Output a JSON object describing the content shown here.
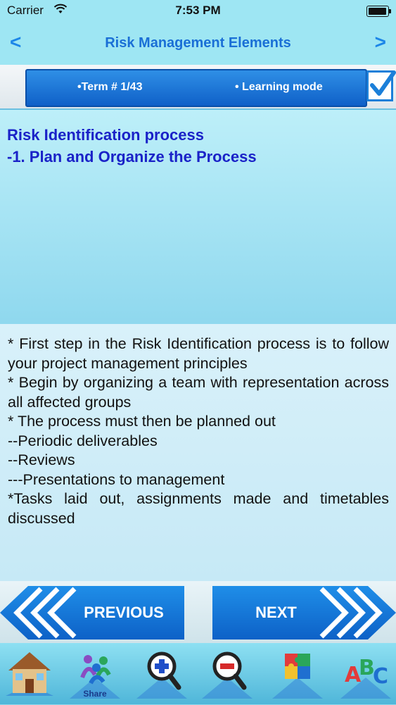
{
  "status": {
    "carrier": "Carrier",
    "time": "7:53 PM"
  },
  "nav": {
    "back": "<",
    "title": "Risk Management Elements",
    "forward": ">"
  },
  "term": {
    "counter": "•Term #  1/43",
    "mode": "• Learning mode"
  },
  "question": {
    "line1": "Risk Identification process",
    "line2": "-1. Plan and Organize the Process"
  },
  "answer": {
    "lines": [
      "* First step in the Risk Identification process is to follow your project management principles",
      "* Begin by organizing a team with representation across all affected groups",
      "* The process must then be planned out",
      "--Periodic deliverables",
      "--Reviews",
      "---Presentations to management",
      "*Tasks laid out, assignments made and timetables discussed"
    ]
  },
  "buttons": {
    "previous": "PREVIOUS",
    "next": "NEXT"
  },
  "toolbar": {
    "share_label": "Share"
  },
  "colors": {
    "accent": "#1c86e8",
    "question_text": "#1a22c8",
    "button_blue": "#0d61c7"
  }
}
